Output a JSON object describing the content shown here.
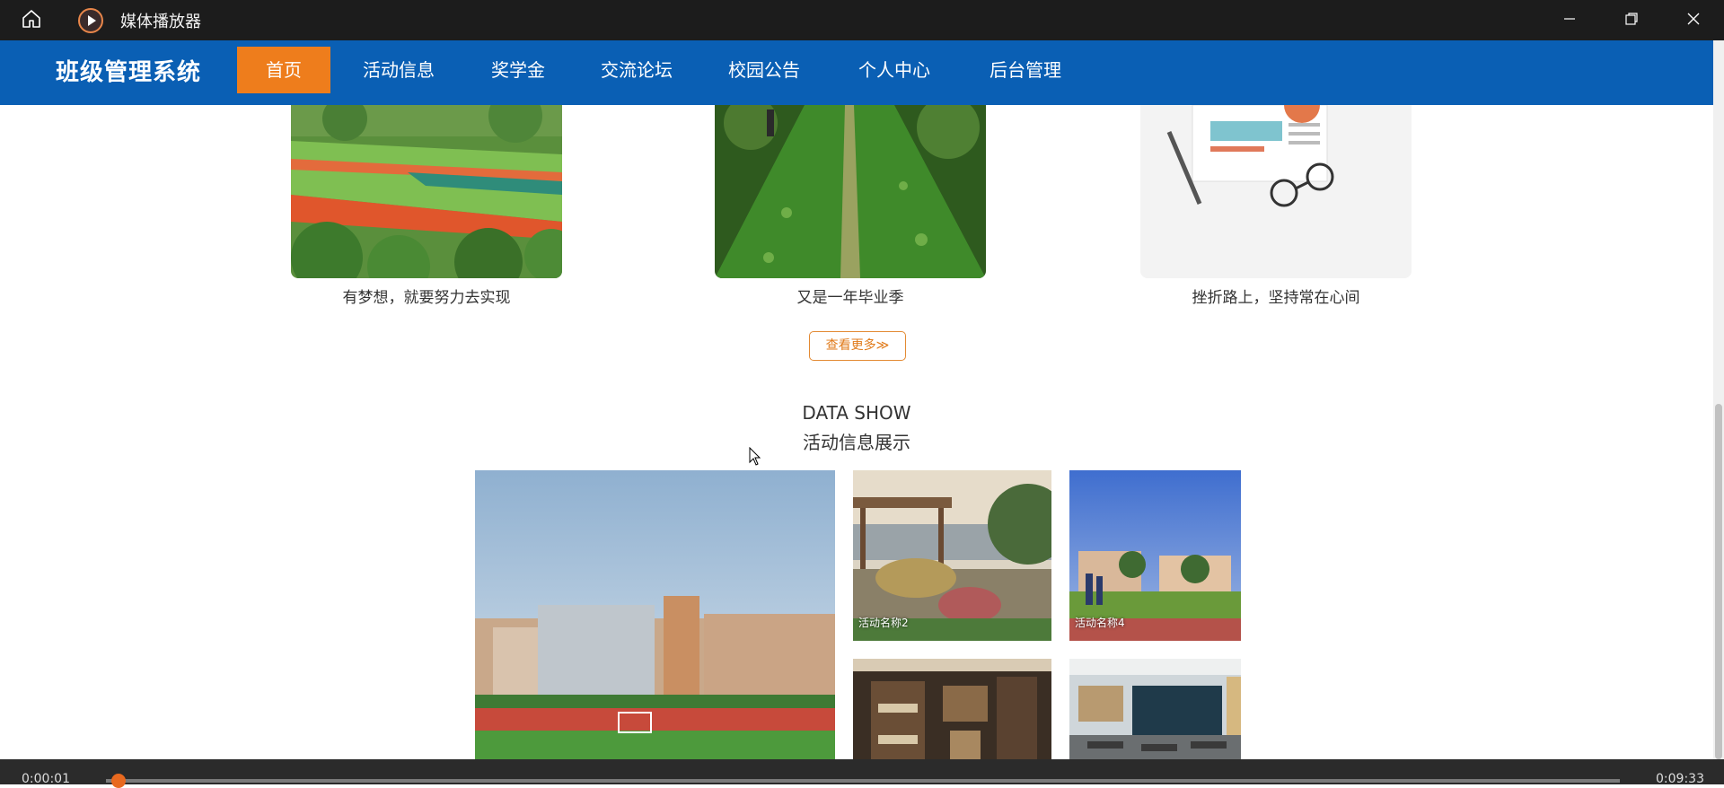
{
  "window": {
    "title": "媒体播放器",
    "home_icon": "home-icon",
    "logo_icon": "media-player-logo-icon",
    "controls": [
      "minimize-icon",
      "restore-icon",
      "close-icon"
    ]
  },
  "site": {
    "brand": "班级管理系统",
    "nav": [
      {
        "label": "首页",
        "active": true
      },
      {
        "label": "活动信息",
        "active": false
      },
      {
        "label": "奖学金",
        "active": false
      },
      {
        "label": "交流论坛",
        "active": false
      },
      {
        "label": "校园公告",
        "active": false
      },
      {
        "label": "个人中心",
        "active": false
      },
      {
        "label": "后台管理",
        "active": false
      }
    ],
    "accent_color": "#ee7d1c",
    "nav_color": "#0a5fb4"
  },
  "gallery": {
    "items": [
      {
        "caption": "有梦想，就要努力去实现"
      },
      {
        "caption": "又是一年毕业季"
      },
      {
        "caption": "挫折路上，坚持常在心间"
      }
    ],
    "more_label": "查看更多≫"
  },
  "data_show": {
    "title_en": "DATA SHOW",
    "title_cn": "活动信息展示",
    "tiles": [
      {
        "label": ""
      },
      {
        "label": "活动名称2"
      },
      {
        "label": "活动名称4"
      },
      {
        "label": ""
      },
      {
        "label": ""
      }
    ]
  },
  "player": {
    "current_time": "0:00:01",
    "total_time": "0:09:33",
    "progress_fraction": 0.002
  }
}
